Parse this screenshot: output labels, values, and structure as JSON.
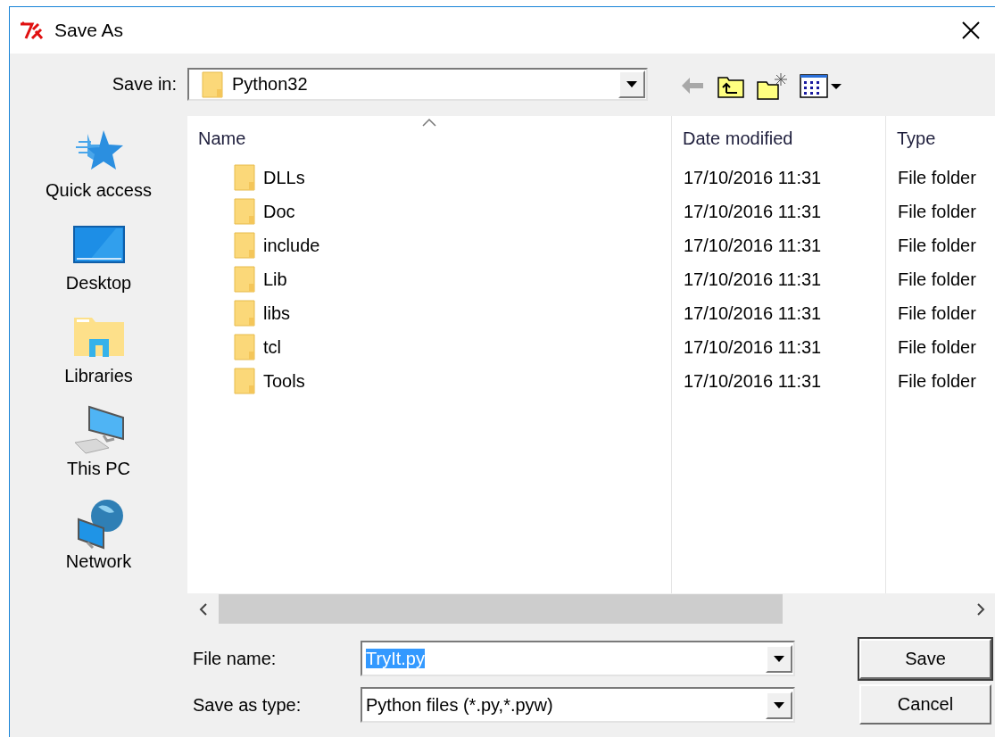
{
  "window": {
    "title": "Save As"
  },
  "save_in": {
    "label": "Save in:",
    "value": "Python32"
  },
  "places": [
    {
      "label": "Quick access",
      "kind": "quick"
    },
    {
      "label": "Desktop",
      "kind": "desktop"
    },
    {
      "label": "Libraries",
      "kind": "libraries"
    },
    {
      "label": "This PC",
      "kind": "pc"
    },
    {
      "label": "Network",
      "kind": "network"
    }
  ],
  "columns": [
    {
      "label": "Name",
      "sorted": true
    },
    {
      "label": "Date modified",
      "sorted": false
    },
    {
      "label": "Type",
      "sorted": false
    }
  ],
  "rows": [
    {
      "name": "DLLs",
      "date": "17/10/2016 11:31",
      "type": "File folder"
    },
    {
      "name": "Doc",
      "date": "17/10/2016 11:31",
      "type": "File folder"
    },
    {
      "name": "include",
      "date": "17/10/2016 11:31",
      "type": "File folder"
    },
    {
      "name": "Lib",
      "date": "17/10/2016 11:31",
      "type": "File folder"
    },
    {
      "name": "libs",
      "date": "17/10/2016 11:31",
      "type": "File folder"
    },
    {
      "name": "tcl",
      "date": "17/10/2016 11:31",
      "type": "File folder"
    },
    {
      "name": "Tools",
      "date": "17/10/2016 11:31",
      "type": "File folder"
    }
  ],
  "file_name": {
    "label": "File name:",
    "value": "TryIt.py",
    "text_selected": true
  },
  "save_as_type": {
    "label": "Save as type:",
    "value": "Python files (*.py,*.pyw)"
  },
  "buttons": [
    {
      "label": "Save",
      "default": true
    },
    {
      "label": "Cancel",
      "default": false
    }
  ]
}
